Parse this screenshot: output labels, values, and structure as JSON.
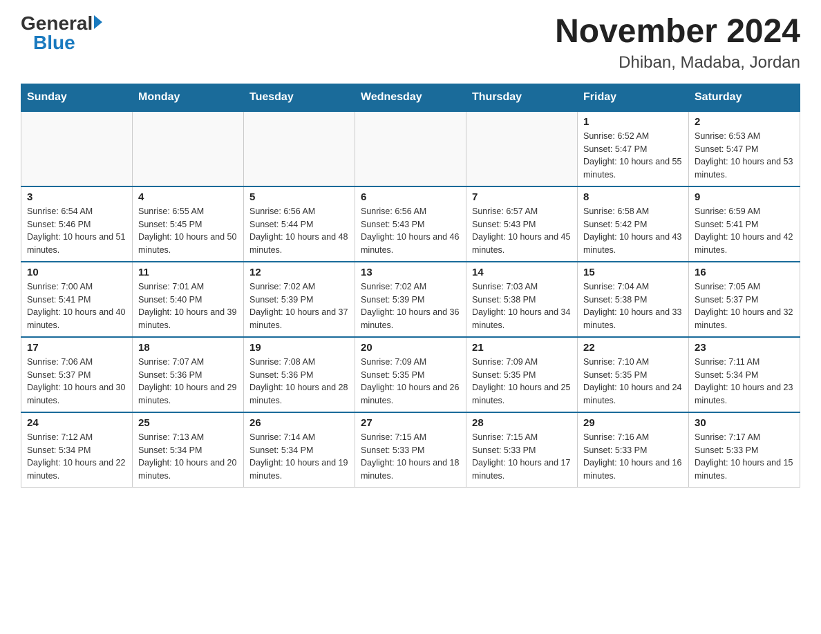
{
  "header": {
    "logo_general": "General",
    "logo_blue": "Blue",
    "title": "November 2024",
    "subtitle": "Dhiban, Madaba, Jordan"
  },
  "days_of_week": [
    "Sunday",
    "Monday",
    "Tuesday",
    "Wednesday",
    "Thursday",
    "Friday",
    "Saturday"
  ],
  "weeks": [
    [
      {
        "day": "",
        "info": ""
      },
      {
        "day": "",
        "info": ""
      },
      {
        "day": "",
        "info": ""
      },
      {
        "day": "",
        "info": ""
      },
      {
        "day": "",
        "info": ""
      },
      {
        "day": "1",
        "info": "Sunrise: 6:52 AM\nSunset: 5:47 PM\nDaylight: 10 hours and 55 minutes."
      },
      {
        "day": "2",
        "info": "Sunrise: 6:53 AM\nSunset: 5:47 PM\nDaylight: 10 hours and 53 minutes."
      }
    ],
    [
      {
        "day": "3",
        "info": "Sunrise: 6:54 AM\nSunset: 5:46 PM\nDaylight: 10 hours and 51 minutes."
      },
      {
        "day": "4",
        "info": "Sunrise: 6:55 AM\nSunset: 5:45 PM\nDaylight: 10 hours and 50 minutes."
      },
      {
        "day": "5",
        "info": "Sunrise: 6:56 AM\nSunset: 5:44 PM\nDaylight: 10 hours and 48 minutes."
      },
      {
        "day": "6",
        "info": "Sunrise: 6:56 AM\nSunset: 5:43 PM\nDaylight: 10 hours and 46 minutes."
      },
      {
        "day": "7",
        "info": "Sunrise: 6:57 AM\nSunset: 5:43 PM\nDaylight: 10 hours and 45 minutes."
      },
      {
        "day": "8",
        "info": "Sunrise: 6:58 AM\nSunset: 5:42 PM\nDaylight: 10 hours and 43 minutes."
      },
      {
        "day": "9",
        "info": "Sunrise: 6:59 AM\nSunset: 5:41 PM\nDaylight: 10 hours and 42 minutes."
      }
    ],
    [
      {
        "day": "10",
        "info": "Sunrise: 7:00 AM\nSunset: 5:41 PM\nDaylight: 10 hours and 40 minutes."
      },
      {
        "day": "11",
        "info": "Sunrise: 7:01 AM\nSunset: 5:40 PM\nDaylight: 10 hours and 39 minutes."
      },
      {
        "day": "12",
        "info": "Sunrise: 7:02 AM\nSunset: 5:39 PM\nDaylight: 10 hours and 37 minutes."
      },
      {
        "day": "13",
        "info": "Sunrise: 7:02 AM\nSunset: 5:39 PM\nDaylight: 10 hours and 36 minutes."
      },
      {
        "day": "14",
        "info": "Sunrise: 7:03 AM\nSunset: 5:38 PM\nDaylight: 10 hours and 34 minutes."
      },
      {
        "day": "15",
        "info": "Sunrise: 7:04 AM\nSunset: 5:38 PM\nDaylight: 10 hours and 33 minutes."
      },
      {
        "day": "16",
        "info": "Sunrise: 7:05 AM\nSunset: 5:37 PM\nDaylight: 10 hours and 32 minutes."
      }
    ],
    [
      {
        "day": "17",
        "info": "Sunrise: 7:06 AM\nSunset: 5:37 PM\nDaylight: 10 hours and 30 minutes."
      },
      {
        "day": "18",
        "info": "Sunrise: 7:07 AM\nSunset: 5:36 PM\nDaylight: 10 hours and 29 minutes."
      },
      {
        "day": "19",
        "info": "Sunrise: 7:08 AM\nSunset: 5:36 PM\nDaylight: 10 hours and 28 minutes."
      },
      {
        "day": "20",
        "info": "Sunrise: 7:09 AM\nSunset: 5:35 PM\nDaylight: 10 hours and 26 minutes."
      },
      {
        "day": "21",
        "info": "Sunrise: 7:09 AM\nSunset: 5:35 PM\nDaylight: 10 hours and 25 minutes."
      },
      {
        "day": "22",
        "info": "Sunrise: 7:10 AM\nSunset: 5:35 PM\nDaylight: 10 hours and 24 minutes."
      },
      {
        "day": "23",
        "info": "Sunrise: 7:11 AM\nSunset: 5:34 PM\nDaylight: 10 hours and 23 minutes."
      }
    ],
    [
      {
        "day": "24",
        "info": "Sunrise: 7:12 AM\nSunset: 5:34 PM\nDaylight: 10 hours and 22 minutes."
      },
      {
        "day": "25",
        "info": "Sunrise: 7:13 AM\nSunset: 5:34 PM\nDaylight: 10 hours and 20 minutes."
      },
      {
        "day": "26",
        "info": "Sunrise: 7:14 AM\nSunset: 5:34 PM\nDaylight: 10 hours and 19 minutes."
      },
      {
        "day": "27",
        "info": "Sunrise: 7:15 AM\nSunset: 5:33 PM\nDaylight: 10 hours and 18 minutes."
      },
      {
        "day": "28",
        "info": "Sunrise: 7:15 AM\nSunset: 5:33 PM\nDaylight: 10 hours and 17 minutes."
      },
      {
        "day": "29",
        "info": "Sunrise: 7:16 AM\nSunset: 5:33 PM\nDaylight: 10 hours and 16 minutes."
      },
      {
        "day": "30",
        "info": "Sunrise: 7:17 AM\nSunset: 5:33 PM\nDaylight: 10 hours and 15 minutes."
      }
    ]
  ]
}
